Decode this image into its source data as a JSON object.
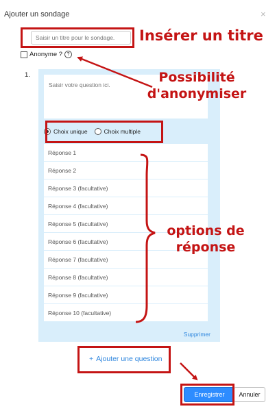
{
  "dialog": {
    "title": "Ajouter un sondage",
    "close_symbol": "×"
  },
  "form": {
    "title_placeholder": "Saisir un titre pour le sondage.",
    "anonymous_label": "Anonyme ?",
    "help_symbol": "?"
  },
  "question": {
    "number": "1.",
    "placeholder": "Saisir votre question ici.",
    "choice_single": "Choix unique",
    "choice_multiple": "Choix multiple",
    "selected_choice": "Choix unique",
    "answers": [
      "Réponse 1",
      "Réponse 2",
      "Réponse 3 (facultative)",
      "Réponse 4 (facultative)",
      "Réponse 5 (facultative)",
      "Réponse 6 (facultative)",
      "Réponse 7 (facultative)",
      "Réponse 8 (facultative)",
      "Réponse 9 (facultative)",
      "Réponse 10 (facultative)"
    ],
    "delete_label": "Supprimer"
  },
  "actions": {
    "add_question_plus": "+",
    "add_question_label": "Ajouter une question",
    "save_label": "Enregistrer",
    "cancel_label": "Annuler"
  },
  "annotations": {
    "title_note": "Insérer un titre",
    "anonymous_note_line1": "Possibilité",
    "anonymous_note_line2": "d'anonymiser",
    "options_note_line1": "options de",
    "options_note_line2": "réponse"
  },
  "colors": {
    "annotation_red": "#c41414",
    "panel_blue": "#d9eefb",
    "accent_blue": "#2d8cff",
    "link_blue": "#2e86de"
  }
}
